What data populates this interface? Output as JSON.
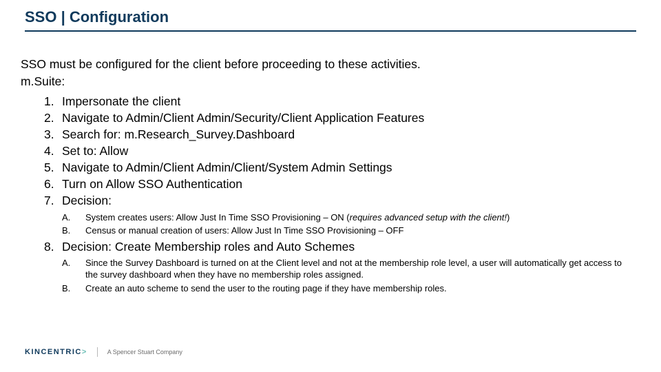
{
  "title": "SSO | Configuration",
  "intro": "SSO must be configured for the client before proceeding to these activities.",
  "suite_label": "m.Suite:",
  "steps": [
    {
      "n": "1.",
      "t": "Impersonate the client"
    },
    {
      "n": "2.",
      "t": "Navigate to Admin/Client Admin/Security/Client Application Features"
    },
    {
      "n": "3.",
      "t": "Search for: m.Research_Survey.Dashboard"
    },
    {
      "n": "4.",
      "t": "Set to: Allow"
    },
    {
      "n": "5.",
      "t": "Navigate to Admin/Client Admin/Client/System Admin Settings"
    },
    {
      "n": "6.",
      "t": "Turn on Allow SSO Authentication"
    },
    {
      "n": "7.",
      "t": "Decision:"
    }
  ],
  "sub7": [
    {
      "m": "A.",
      "pre": "System creates users: Allow Just In Time SSO Provisioning – ON (",
      "em": "requires advanced setup with the client!",
      "post": ")"
    },
    {
      "m": "B.",
      "pre": "Census or manual creation of users: Allow Just In Time SSO Provisioning – OFF",
      "em": "",
      "post": ""
    }
  ],
  "step8": {
    "n": "8.",
    "t": "Decision: Create Membership roles and Auto Schemes"
  },
  "sub8": [
    {
      "m": "A.",
      "t": "Since the Survey Dashboard is turned on at the Client level and not at the membership role level, a user will automatically get access to the survey dashboard when they have no membership roles assigned."
    },
    {
      "m": "B.",
      "t": "Create an auto scheme to send the user to the routing page if they have membership roles."
    }
  ],
  "footer": {
    "brand_main": "KINCENTRIC",
    "brand_gt": ">",
    "tagline": "A Spencer Stuart Company"
  }
}
